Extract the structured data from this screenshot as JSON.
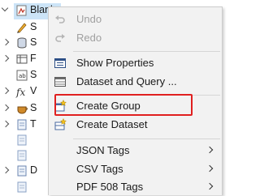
{
  "tree": {
    "root_label": "Blank",
    "rows": [
      {
        "label": "S",
        "icon": "pencil-icon"
      },
      {
        "label": "S",
        "icon": "data-source-icon"
      },
      {
        "label": "F",
        "icon": "dataset-icon"
      },
      {
        "label": "S",
        "icon": "script-icon"
      },
      {
        "label": "V",
        "icon": "fx-icon"
      },
      {
        "label": "S",
        "icon": "style-icon"
      },
      {
        "label": "T",
        "icon": "page-icon"
      },
      {
        "label": "",
        "icon": "page-icon"
      },
      {
        "label": "",
        "icon": "page-icon"
      },
      {
        "label": "",
        "icon": "page-icon"
      },
      {
        "label": "D",
        "icon": "page-icon"
      },
      {
        "label": "",
        "icon": "page-icon"
      },
      {
        "label": "",
        "icon": "page-icon"
      }
    ]
  },
  "menu": {
    "undo": "Undo",
    "redo": "Redo",
    "show_properties": "Show Properties",
    "dataset_and_query": "Dataset and Query ...",
    "create_group": "Create Group",
    "create_dataset": "Create Dataset",
    "json_tags": "JSON Tags",
    "csv_tags": "CSV Tags",
    "pdf508_tags": "PDF 508 Tags"
  },
  "colors": {
    "highlight_border": "#e02020",
    "menu_background": "#f2f2f2",
    "selection_background": "#cce4f7"
  }
}
